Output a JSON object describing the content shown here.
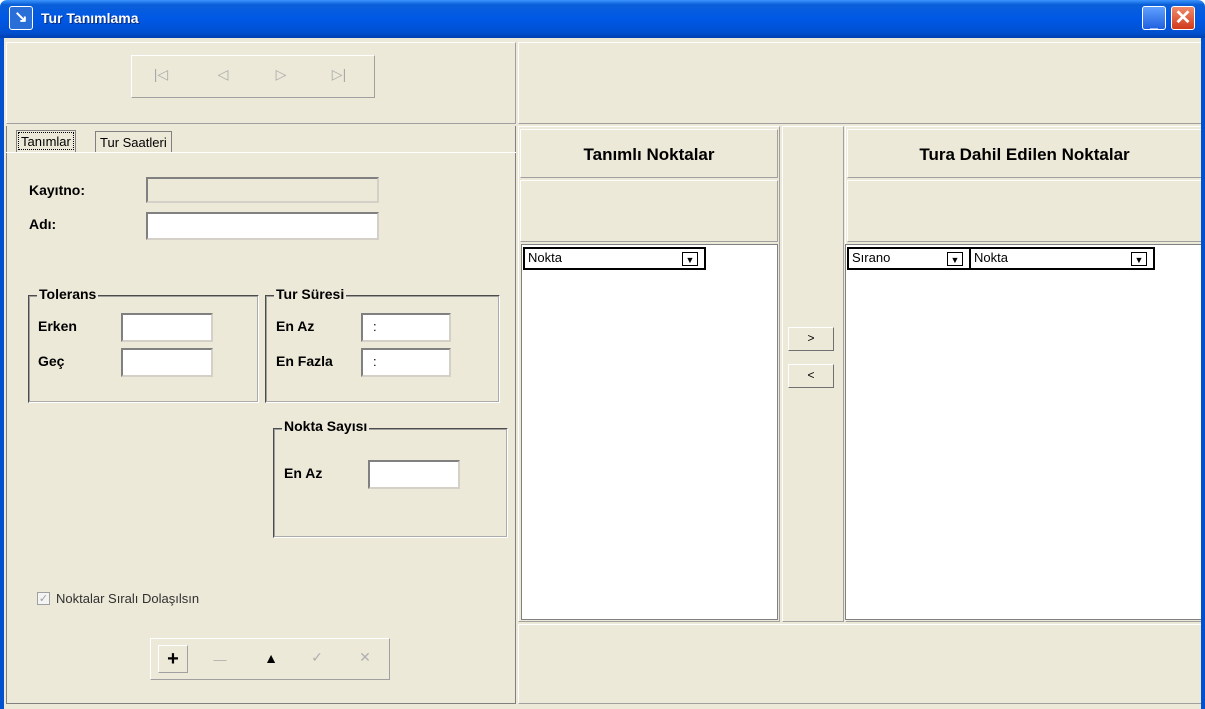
{
  "window": {
    "title": "Tur Tanımlama",
    "icon": "arrow-icon",
    "minimize": "_",
    "close": "✕"
  },
  "navigator": {
    "first": "|◁",
    "prev": "◁",
    "next": "▷",
    "last": "▷|"
  },
  "tabs": [
    {
      "label": "Tanımlar"
    },
    {
      "label": "Tur Saatleri"
    }
  ],
  "form": {
    "kayitno_label": "Kayıtno:",
    "kayitno_value": "",
    "adi_label": "Adı:",
    "adi_value": "",
    "tolerans": {
      "title": "Tolerans",
      "erken_label": "Erken",
      "erken_value": "",
      "gec_label": "Geç",
      "gec_value": ""
    },
    "tur_suresi": {
      "title": "Tur Süresi",
      "en_az_label": "En Az",
      "en_az_value": ":",
      "en_fazla_label": "En Fazla",
      "en_fazla_value": ":"
    },
    "nokta_sayisi": {
      "title": "Nokta Sayısı",
      "en_az_label": "En Az",
      "en_az_value": ""
    },
    "sirali_checkbox": {
      "label": "Noktalar Sıralı Dolaşılsın",
      "checked": true
    }
  },
  "toolbar": {
    "add": "+",
    "delete": "—",
    "up": "▲",
    "post": "✓",
    "cancel": "✕"
  },
  "left_list": {
    "title": "Tanımlı Noktalar",
    "column": "Nokta"
  },
  "right_list": {
    "title": "Tura Dahil Edilen Noktalar",
    "column1": "Sırano",
    "column2": "Nokta"
  },
  "move_buttons": {
    "add": ">",
    "remove": "<"
  },
  "dropdown_glyph": "▼",
  "colors": {
    "titlebar": "#0058e6",
    "window_bg": "#ece9d8"
  }
}
